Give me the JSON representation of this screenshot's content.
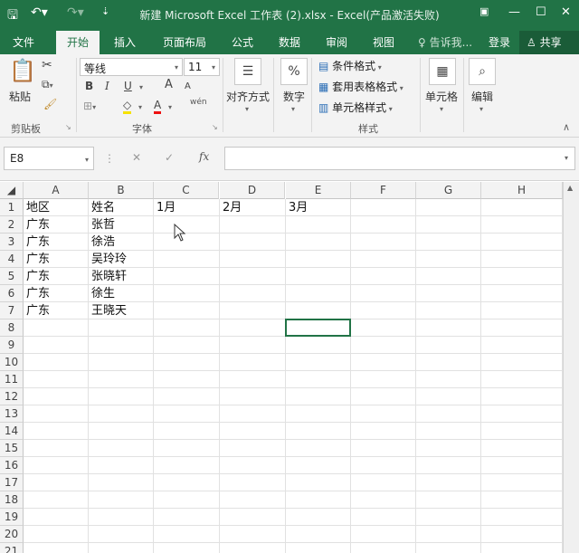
{
  "titlebar": {
    "title": "新建 Microsoft Excel 工作表 (2).xlsx - Excel(产品激活失败)"
  },
  "tabs": [
    "文件",
    "开始",
    "插入",
    "页面布局",
    "公式",
    "数据",
    "审阅",
    "视图"
  ],
  "tellme": "告诉我...",
  "signin": "登录",
  "share": "共享",
  "ribbon": {
    "clipboard": {
      "paste": "粘贴",
      "label": "剪贴板"
    },
    "font": {
      "name": "等线",
      "size": "11",
      "bold": "B",
      "italic": "I",
      "underline": "U",
      "grow": "A",
      "shrink": "A",
      "color_a": "A",
      "wen": "wén",
      "label": "字体"
    },
    "alignment": {
      "label": "对齐方式"
    },
    "number": {
      "symbol": "%",
      "label": "数字"
    },
    "styles": {
      "conditional": "条件格式",
      "table": "套用表格格式",
      "cell": "单元格样式",
      "label": "样式"
    },
    "cells": {
      "label": "单元格"
    },
    "editing": {
      "label": "编辑"
    }
  },
  "formula_bar": {
    "name_box": "E8",
    "fx": "fx",
    "value": ""
  },
  "sheet": {
    "columns": [
      "A",
      "B",
      "C",
      "D",
      "E",
      "F",
      "G",
      "H"
    ],
    "rows": [
      "1",
      "2",
      "3",
      "4",
      "5",
      "6",
      "7",
      "8",
      "9",
      "10",
      "11",
      "12",
      "13",
      "14",
      "15",
      "16",
      "17",
      "18",
      "19",
      "20",
      "21"
    ],
    "cells": [
      [
        "地区",
        "姓名",
        "1月",
        "2月",
        "3月"
      ],
      [
        "广东",
        "张哲"
      ],
      [
        "广东",
        "徐浩"
      ],
      [
        "广东",
        "吴玲玲"
      ],
      [
        "广东",
        "张晓轩"
      ],
      [
        "广东",
        "徐生"
      ],
      [
        "广东",
        "王晓天"
      ]
    ]
  },
  "colors": {
    "accent": "#217346"
  }
}
